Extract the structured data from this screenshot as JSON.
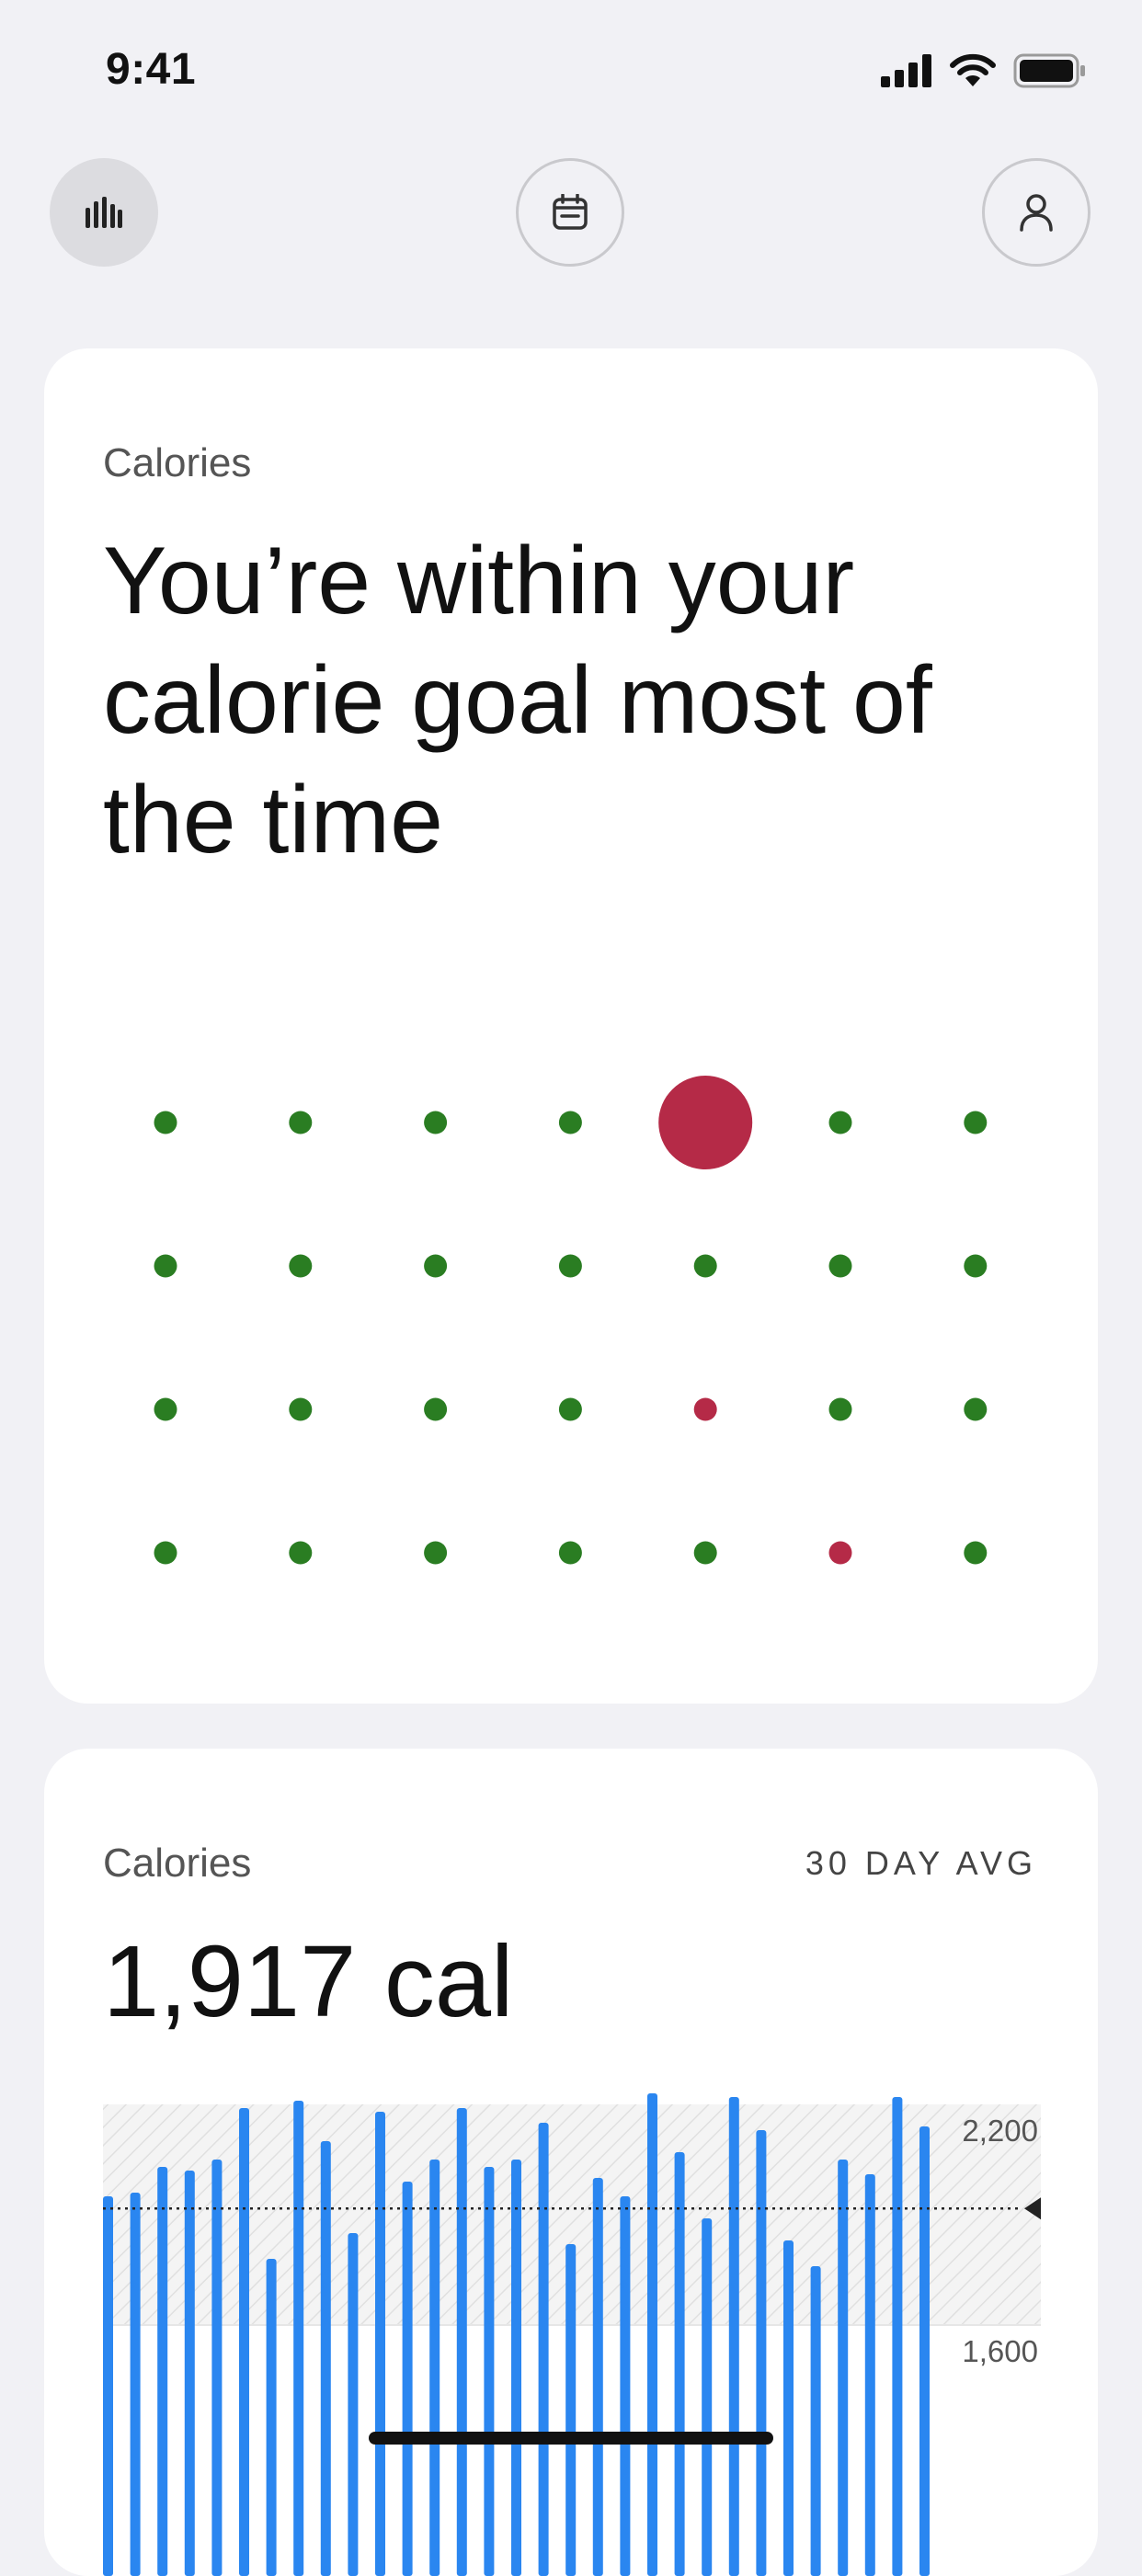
{
  "status_bar": {
    "time": "9:41"
  },
  "nav": {
    "insights_icon": "bar-chart-icon",
    "calendar_icon": "calendar-icon",
    "profile_icon": "person-icon"
  },
  "insight_card": {
    "eyebrow": "Calories",
    "headline": "You’re within your calorie goal most of the time",
    "colors": {
      "within": "#2a7d22",
      "over": "#b52a47"
    },
    "grid": {
      "columns": 7,
      "rows": [
        [
          "within",
          "within",
          "within",
          "within",
          "over-today",
          "within",
          "within"
        ],
        [
          "within",
          "within",
          "within",
          "within",
          "within",
          "within",
          "within"
        ],
        [
          "within",
          "within",
          "within",
          "within",
          "over",
          "within",
          "within"
        ],
        [
          "within",
          "within",
          "within",
          "within",
          "within",
          "over",
          "within"
        ]
      ]
    }
  },
  "average_card": {
    "eyebrow": "Calories",
    "period_label": "30 DAY AVG",
    "value": "1,917 cal",
    "chart_data": {
      "type": "bar",
      "color": "#2a86f0",
      "y_ticks": [
        "2,200",
        "1,600"
      ],
      "goal_band": [
        1600,
        2200
      ],
      "average_line": 1917,
      "ylim": [
        1400,
        2200
      ],
      "values": [
        1950,
        1960,
        2030,
        2020,
        2050,
        2190,
        1780,
        2210,
        2100,
        1850,
        2180,
        1990,
        2050,
        2190,
        2030,
        2050,
        2150,
        1820,
        2000,
        1950,
        2230,
        2070,
        1890,
        2220,
        2130,
        1830,
        1760,
        2050,
        2010,
        2220,
        2140
      ]
    }
  }
}
